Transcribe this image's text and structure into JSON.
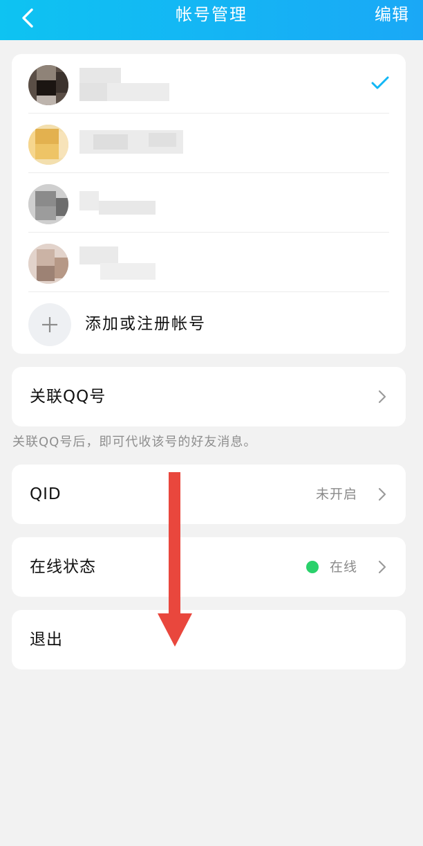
{
  "header": {
    "title": "帐号管理",
    "edit_label": "编辑",
    "back_icon": "chevron-left-icon"
  },
  "accounts": {
    "items": [
      {
        "name": "",
        "selected": true
      },
      {
        "name": "",
        "selected": false
      },
      {
        "name": "",
        "selected": false
      },
      {
        "name": "",
        "selected": false
      }
    ],
    "add_label": "添加或注册帐号"
  },
  "link_qq": {
    "label": "关联QQ号",
    "hint": "关联QQ号后，即可代收该号的好友消息。"
  },
  "qid": {
    "label": "QID",
    "value": "未开启"
  },
  "online_status": {
    "label": "在线状态",
    "value": "在线"
  },
  "logout": {
    "label": "退出"
  },
  "colors": {
    "header_start": "#0ec3f2",
    "header_end": "#1aa8f6",
    "check": "#12b7f5",
    "online_dot": "#2ad16b",
    "arrow": "#e9473d"
  }
}
